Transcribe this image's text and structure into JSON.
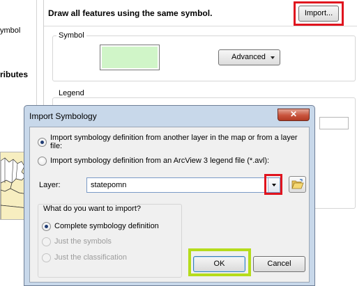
{
  "left_panel": {
    "items": [
      "ymbol",
      "ributes"
    ]
  },
  "symbology": {
    "title": "Draw all features using the same symbol.",
    "import_button": "Import...",
    "symbol_group": "Symbol",
    "symbol_fill_color": "#d0f5c8",
    "advanced_button": "Advanced",
    "legend_group": "Legend"
  },
  "dialog": {
    "title": "Import Symbology",
    "close_glyph": "✕",
    "options": [
      "Import symbology definition from another layer in the map or from a layer file:",
      "Import symbology definition from an ArcView 3 legend file (*.avl):"
    ],
    "selected_option": 0,
    "layer_label": "Layer:",
    "layer_value": "statepomn",
    "import_group_label": "What do you want to import?",
    "import_options": [
      {
        "label": "Complete symbology definition",
        "checked": true,
        "enabled": true
      },
      {
        "label": "Just the symbols",
        "checked": false,
        "enabled": false
      },
      {
        "label": "Just the classification",
        "checked": false,
        "enabled": false
      }
    ],
    "ok_button": "OK",
    "cancel_button": "Cancel"
  },
  "highlight_colors": {
    "red": "#e0141e",
    "green": "#b5dc1c"
  }
}
